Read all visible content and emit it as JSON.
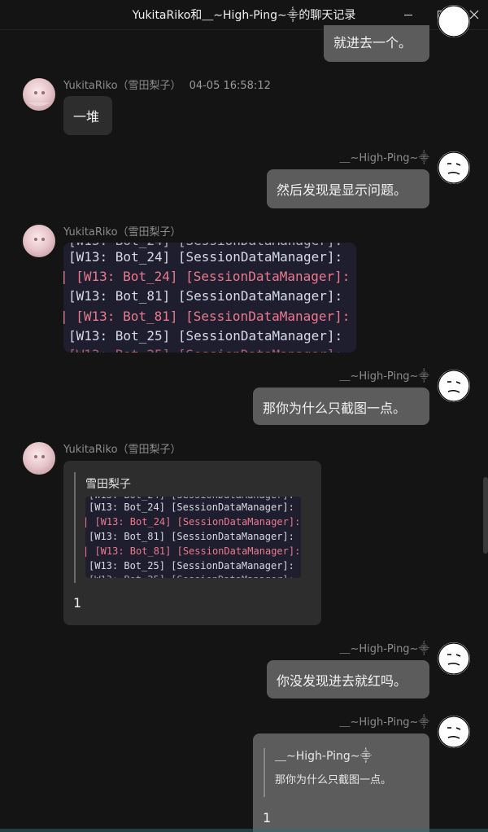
{
  "window": {
    "title": "YukitaRiko和⸏∼High-Ping∼⸎的聊天记录",
    "min_icon": "minimize-icon",
    "max_icon": "maximize-icon",
    "close_icon": "close-icon"
  },
  "messages": [
    {
      "side": "right",
      "text": "就进去一个。"
    },
    {
      "side": "left",
      "sender": "YukitaRiko（雪田梨子）",
      "time": "04-05 16:58:12",
      "text": "一堆"
    },
    {
      "side": "right",
      "sender": "⸏∼High-Ping∼⸎",
      "text": "然后发现是显示问题。"
    },
    {
      "side": "left",
      "sender": "YukitaRiko（雪田梨子）",
      "code_lines": [
        "[W13: Bot_24] [SessionDataManager]:",
        "| [W13: Bot_24] [SessionDataManager]:",
        "[W13: Bot_81] [SessionDataManager]:",
        "| [W13: Bot_81] [SessionDataManager]:",
        "[W13: Bot_25] [SessionDataManager]:"
      ]
    },
    {
      "side": "right",
      "sender": "⸏∼High-Ping∼⸎",
      "text": "那你为什么只截图一点。"
    },
    {
      "side": "left",
      "sender": "YukitaRiko（雪田梨子）",
      "quote_name": "雪田梨子",
      "code_lines": [
        "[W13: Bot_24] [SessionDataManager]:",
        "| [W13: Bot_24] [SessionDataManager]:",
        "[W13: Bot_81] [SessionDataManager]:",
        "| [W13: Bot_81] [SessionDataManager]:",
        "[W13: Bot_25] [SessionDataManager]:"
      ],
      "text": "1"
    },
    {
      "side": "right",
      "sender": "⸏∼High-Ping∼⸎",
      "text": "你没发现进去就红吗。"
    },
    {
      "side": "right",
      "sender": "⸏∼High-Ping∼⸎",
      "quote_name": "⸏∼High-Ping∼⸎",
      "quote_text": "那你为什么只截图一点。",
      "text": "1"
    }
  ],
  "colors": {
    "background": "#141414",
    "bubble_left": "#2d2d2d",
    "bubble_right": "#5c5c5c",
    "code_bg": "#1e1e2e",
    "code_red": "#ea7a8e"
  }
}
